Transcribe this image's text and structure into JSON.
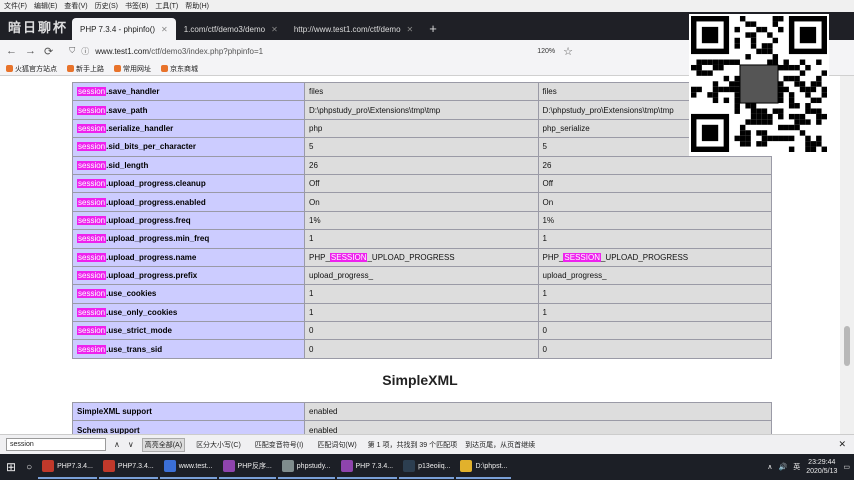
{
  "menubar": [
    "文件(F)",
    "编辑(E)",
    "查看(V)",
    "历史(S)",
    "书签(B)",
    "工具(T)",
    "帮助(H)"
  ],
  "tabs": [
    {
      "label": "PHP 7.3.4 - phpinfo()",
      "active": true
    },
    {
      "label": "1.com/ctf/demo3/demo",
      "active": false
    },
    {
      "label": "http://www.test1.com/ctf/demo",
      "active": false
    }
  ],
  "url": {
    "host": "www.test1.com",
    "path": "/ctf/demo3/index.php?phpinfo=1"
  },
  "zoom": "120%",
  "bookmarks": [
    "火狐官方站点",
    "新手上路",
    "常用网址",
    "京东商城"
  ],
  "highlight_word": "session",
  "session_rows": [
    {
      "suffix": ".save_handler",
      "local": "files",
      "master": "files"
    },
    {
      "suffix": ".save_path",
      "local": "D:\\phpstudy_pro\\Extensions\\tmp\\tmp",
      "master": "D:\\phpstudy_pro\\Extensions\\tmp\\tmp"
    },
    {
      "suffix": ".serialize_handler",
      "local": "php",
      "master": "php_serialize"
    },
    {
      "suffix": ".sid_bits_per_character",
      "local": "5",
      "master": "5"
    },
    {
      "suffix": ".sid_length",
      "local": "26",
      "master": "26"
    },
    {
      "suffix": ".upload_progress.cleanup",
      "local": "Off",
      "master": "Off"
    },
    {
      "suffix": ".upload_progress.enabled",
      "local": "On",
      "master": "On"
    },
    {
      "suffix": ".upload_progress.freq",
      "local": "1%",
      "master": "1%"
    },
    {
      "suffix": ".upload_progress.min_freq",
      "local": "1",
      "master": "1"
    },
    {
      "suffix": ".upload_progress.name",
      "local_pre": "PHP_",
      "local_hl": "SESSION",
      "local_post": "_UPLOAD_PROGRESS",
      "master_pre": "PHP_",
      "master_hl": "SESSION",
      "master_post": "_UPLOAD_PROGRESS"
    },
    {
      "suffix": ".upload_progress.prefix",
      "local": "upload_progress_",
      "master": "upload_progress_"
    },
    {
      "suffix": ".use_cookies",
      "local": "1",
      "master": "1"
    },
    {
      "suffix": ".use_only_cookies",
      "local": "1",
      "master": "1"
    },
    {
      "suffix": ".use_strict_mode",
      "local": "0",
      "master": "0"
    },
    {
      "suffix": ".use_trans_sid",
      "local": "0",
      "master": "0"
    }
  ],
  "simplexml": {
    "title": "SimpleXML",
    "rows": [
      {
        "name": "SimpleXML support",
        "value": "enabled"
      },
      {
        "name": "Schema support",
        "value": "enabled"
      }
    ]
  },
  "findbar": {
    "query": "session",
    "highlight_all": "高亮全部(A)",
    "match_case": "区分大小写(C)",
    "match_diacritics": "匹配变音符号(I)",
    "whole_words": "匹配词句(W)",
    "status": "第 1 项，共找到 39 个匹配项",
    "wrap": "到达页尾，从页首继续"
  },
  "taskbar": {
    "items": [
      "PHP7.3.4...",
      "PHP7.3.4...",
      "www.test...",
      "PHP反序...",
      "phpstudy...",
      "PHP 7.3.4...",
      "p13eoiiq...",
      "D:\\phpst..."
    ],
    "time": "23:29:44",
    "date": "2020/5/13",
    "ime": "英",
    "colors": [
      "#c0392b",
      "#c0392b",
      "#3b6fd6",
      "#8e44ad",
      "#7f8c8d",
      "#8e44ad",
      "#2c3e50",
      "#e1b12c"
    ]
  }
}
